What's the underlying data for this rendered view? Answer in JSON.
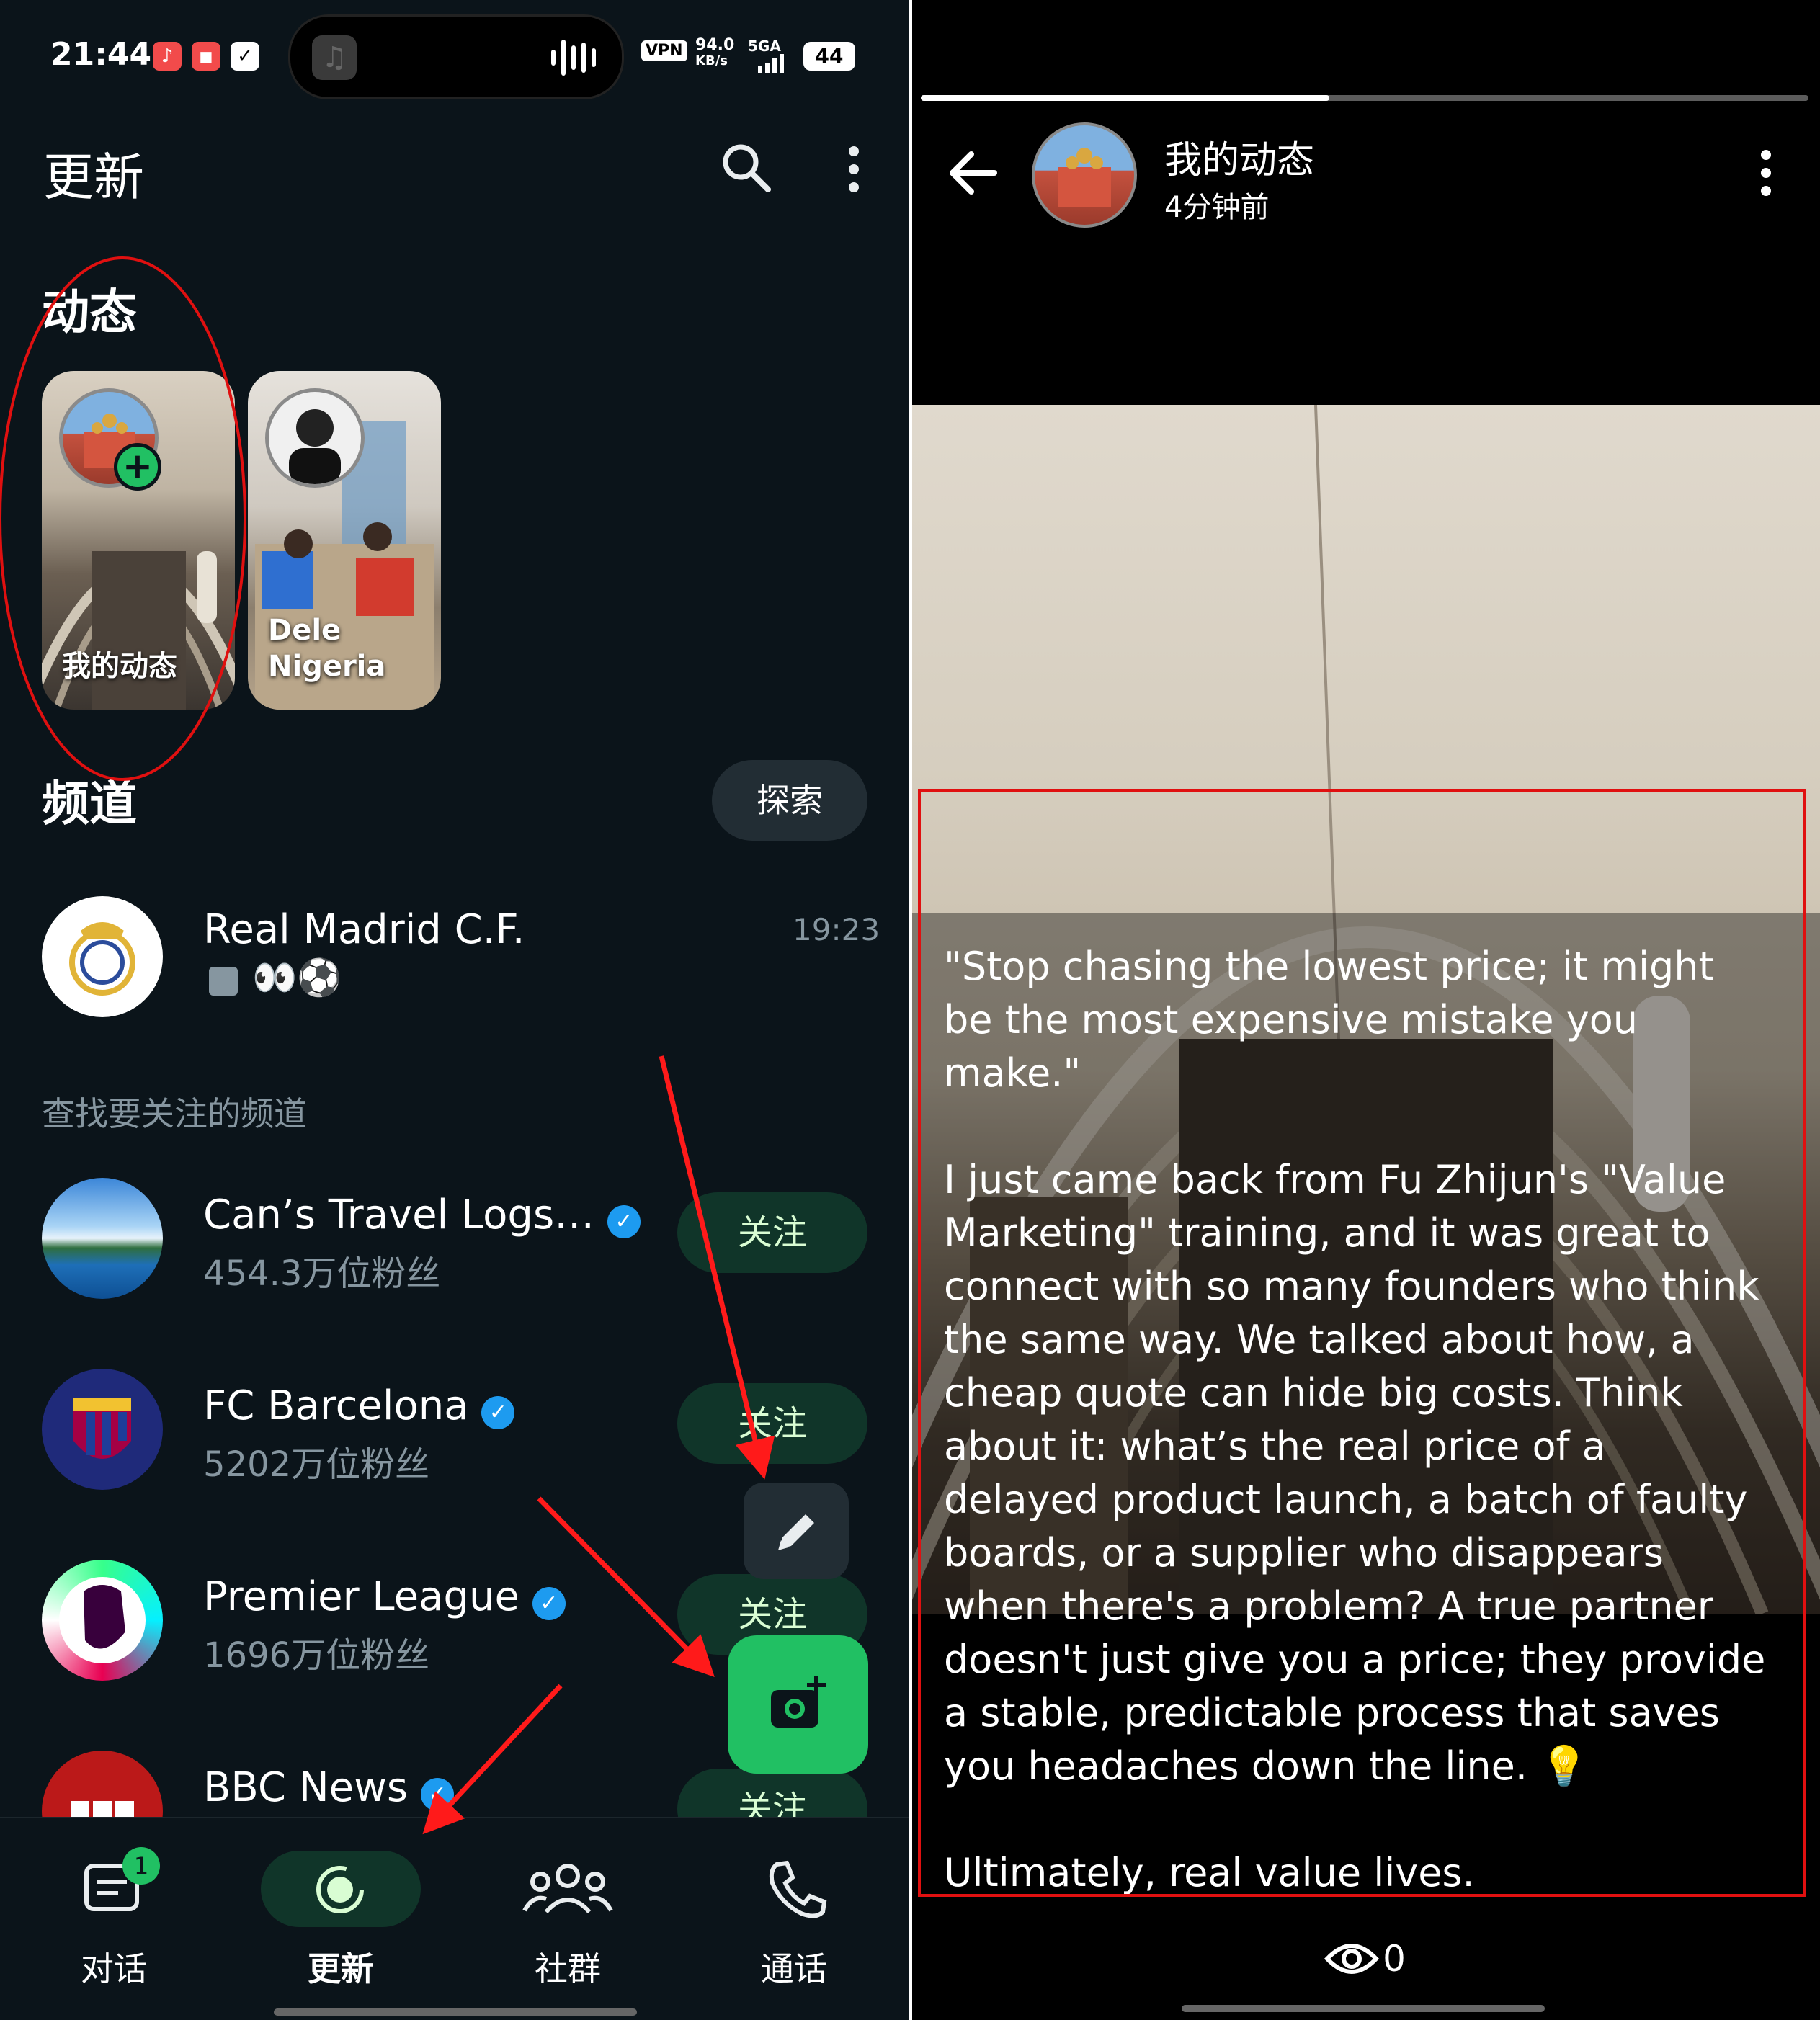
{
  "left": {
    "status_bar": {
      "time": "21:44",
      "vpn": "VPN",
      "speed_value": "94.0",
      "speed_unit": "KB/s",
      "network": "5GA",
      "battery": "44"
    },
    "header": {
      "title": "更新"
    },
    "status_section": {
      "title": "动态",
      "cards": [
        {
          "label": "我的动态"
        },
        {
          "label": "Dele\nNigeria"
        }
      ]
    },
    "channels_section": {
      "title": "频道",
      "explore_label": "探索",
      "followed": [
        {
          "name": "Real Madrid C.F.",
          "time": "19:23",
          "preview": "👀⚽"
        }
      ],
      "find_label": "查找要关注的频道",
      "suggestions": [
        {
          "name": "Can’s Travel Logs…",
          "followers": "454.3万位粉丝",
          "follow_label": "关注"
        },
        {
          "name": "FC Barcelona",
          "followers": "5202万位粉丝",
          "follow_label": "关注"
        },
        {
          "name": "Premier League",
          "followers": "1696万位粉丝",
          "follow_label": "关注"
        },
        {
          "name": "BBC News",
          "followers": "",
          "follow_label": "关注"
        }
      ]
    },
    "bottom_nav": [
      {
        "label": "对话",
        "badge": "1",
        "icon": "chats-icon"
      },
      {
        "label": "更新",
        "icon": "updates-icon"
      },
      {
        "label": "社群",
        "icon": "communities-icon"
      },
      {
        "label": "通话",
        "icon": "calls-icon"
      }
    ],
    "colors": {
      "accent": "#21c063",
      "background": "#0b141a",
      "annotation": "#ff1a1a"
    }
  },
  "right": {
    "header": {
      "title": "我的动态",
      "time_ago": "4分钟前"
    },
    "status_text": "\"Stop chasing the lowest price; it might be the most expensive mistake you make.\"\n\nI just came back from Fu Zhijun's \"Value Marketing\" training, and it was great to connect with so many founders who think the same way. We talked about how, a cheap quote can hide big costs. Think about it: what’s the real price of a delayed product launch, a batch of faulty boards, or a supplier who disappears when there's a problem? A true partner doesn't just give you a price; they provide a stable, predictable process that saves you headaches down the line. 💡\n\nUltimately, real value lives.",
    "views": "0"
  }
}
